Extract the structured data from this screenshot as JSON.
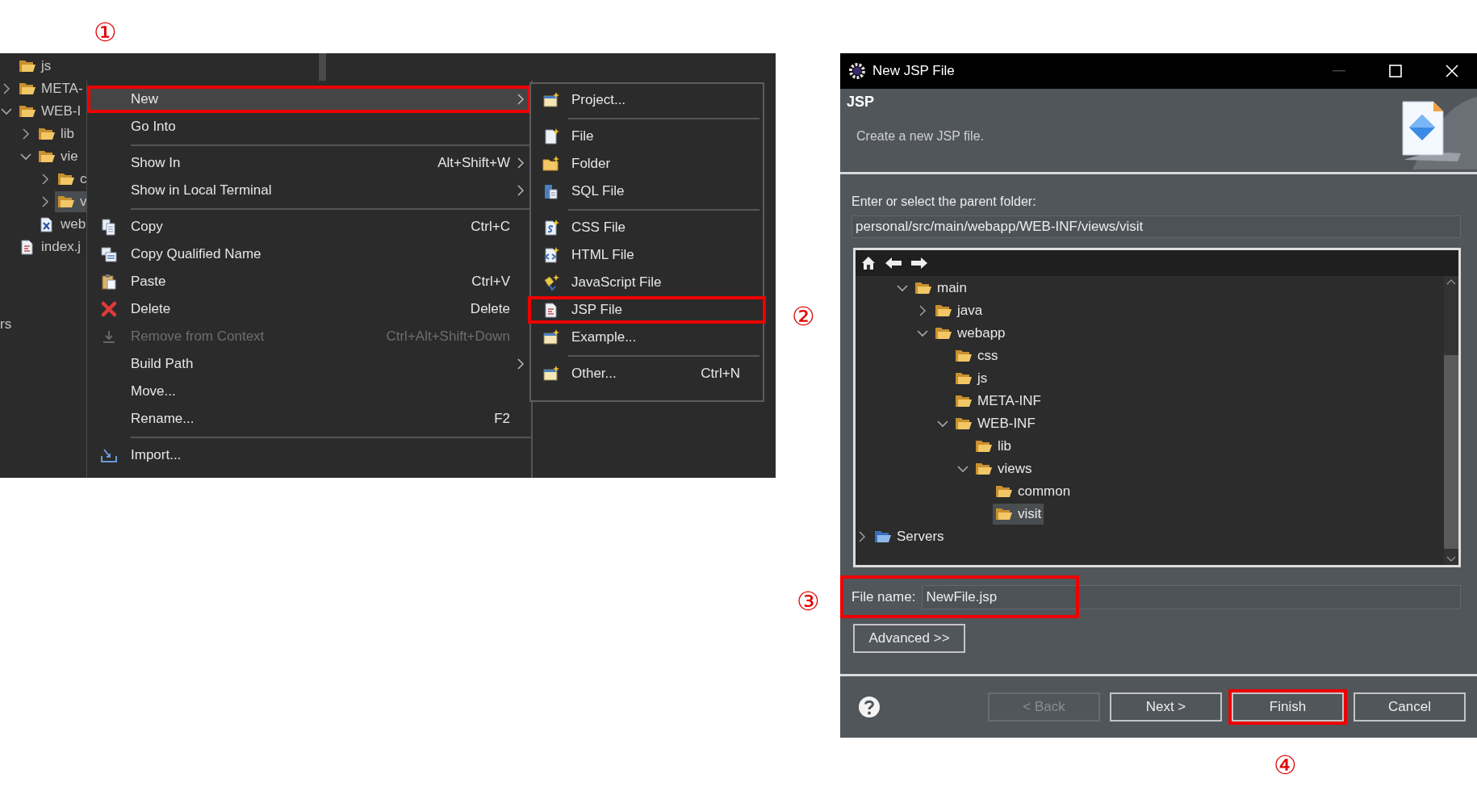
{
  "markers": [
    {
      "label": "①"
    },
    {
      "label": "②"
    },
    {
      "label": "③"
    },
    {
      "label": "④"
    }
  ],
  "explorer": {
    "items": [
      {
        "label": "js",
        "kind": "folder",
        "selected": false
      },
      {
        "label": "META-",
        "kind": "folder",
        "expanded": false,
        "selected": false
      },
      {
        "label": "WEB-I",
        "kind": "folder",
        "expanded": true,
        "selected": false,
        "children": [
          {
            "label": "lib",
            "kind": "folder",
            "expanded": false,
            "selected": false
          },
          {
            "label": "vie",
            "kind": "folder",
            "expanded": true,
            "selected": false,
            "children": [
              {
                "label": "c",
                "kind": "folder",
                "expanded": false,
                "selected": false
              },
              {
                "label": "v",
                "kind": "folder",
                "expanded": false,
                "selected": true
              }
            ]
          },
          {
            "label": "web",
            "kind": "xml-file",
            "selected": false
          }
        ]
      },
      {
        "label": "index.j",
        "kind": "jsp-file",
        "selected": false
      }
    ],
    "edge_label": "rs"
  },
  "context_menu": {
    "items": [
      {
        "kind": "plain",
        "label": "New",
        "submenu": true,
        "selected": true,
        "highlighted": true,
        "disabled": false
      },
      {
        "kind": "plain",
        "label": "Go Into",
        "submenu": false,
        "selected": false,
        "highlighted": false,
        "disabled": false
      },
      {
        "kind": "separator"
      },
      {
        "kind": "plain",
        "label": "Show In",
        "shortcut": "Alt+Shift+W",
        "submenu": true,
        "selected": false,
        "highlighted": false,
        "disabled": false
      },
      {
        "kind": "plain",
        "label": "Show in Local Terminal",
        "submenu": true,
        "selected": false,
        "highlighted": false,
        "disabled": false
      },
      {
        "kind": "separator"
      },
      {
        "kind": "copy",
        "label": "Copy",
        "shortcut": "Ctrl+C",
        "submenu": false,
        "selected": false,
        "highlighted": false,
        "disabled": false
      },
      {
        "kind": "copy-qualified",
        "label": "Copy Qualified Name",
        "submenu": false,
        "selected": false,
        "highlighted": false,
        "disabled": false
      },
      {
        "kind": "paste",
        "label": "Paste",
        "shortcut": "Ctrl+V",
        "submenu": false,
        "selected": false,
        "highlighted": false,
        "disabled": false
      },
      {
        "kind": "delete",
        "label": "Delete",
        "shortcut": "Delete",
        "submenu": false,
        "selected": false,
        "highlighted": false,
        "disabled": false
      },
      {
        "kind": "remove",
        "label": "Remove from Context",
        "shortcut": "Ctrl+Alt+Shift+Down",
        "submenu": false,
        "selected": false,
        "highlighted": false,
        "disabled": true
      },
      {
        "kind": "plain",
        "label": "Build Path",
        "submenu": true,
        "selected": false,
        "highlighted": false,
        "disabled": false
      },
      {
        "kind": "plain",
        "label": "Move...",
        "submenu": false,
        "selected": false,
        "highlighted": false,
        "disabled": false
      },
      {
        "kind": "plain",
        "label": "Rename...",
        "shortcut": "F2",
        "submenu": false,
        "selected": false,
        "highlighted": false,
        "disabled": false
      },
      {
        "kind": "separator"
      },
      {
        "kind": "import",
        "label": "Import...",
        "submenu": false,
        "selected": false,
        "highlighted": false,
        "disabled": false
      }
    ]
  },
  "new_submenu": {
    "items": [
      {
        "kind": "new-project",
        "label": "Project...",
        "highlighted": false
      },
      {
        "kind": "separator"
      },
      {
        "kind": "new-file",
        "label": "File",
        "highlighted": false
      },
      {
        "kind": "new-folder",
        "label": "Folder",
        "highlighted": false
      },
      {
        "kind": "sql-file",
        "label": "SQL File",
        "highlighted": false
      },
      {
        "kind": "separator"
      },
      {
        "kind": "css-file",
        "label": "CSS File",
        "highlighted": false
      },
      {
        "kind": "html-file",
        "label": "HTML File",
        "highlighted": false
      },
      {
        "kind": "js-file",
        "label": "JavaScript File",
        "highlighted": false
      },
      {
        "kind": "jsp-file",
        "label": "JSP File",
        "highlighted": true
      },
      {
        "kind": "new-project",
        "label": "Example...",
        "highlighted": false
      },
      {
        "kind": "separator"
      },
      {
        "kind": "new-project",
        "label": "Other...",
        "shortcut": "Ctrl+N",
        "highlighted": false
      }
    ]
  },
  "dialog": {
    "title": "New JSP File",
    "header": {
      "title": "JSP",
      "description": "Create a new JSP file."
    },
    "folder_label": "Enter or select the parent folder:",
    "folder_path": "personal/src/main/webapp/WEB-INF/views/visit",
    "tree": {
      "items": [
        {
          "label": "main",
          "kind": "folder",
          "expanded": true,
          "selected": false,
          "children": [
            {
              "label": "java",
              "kind": "folder",
              "expanded": false,
              "selected": false
            },
            {
              "label": "webapp",
              "kind": "folder",
              "expanded": true,
              "selected": false,
              "children": [
                {
                  "label": "css",
                  "kind": "folder",
                  "selected": false
                },
                {
                  "label": "js",
                  "kind": "folder",
                  "selected": false
                },
                {
                  "label": "META-INF",
                  "kind": "folder",
                  "selected": false
                },
                {
                  "label": "WEB-INF",
                  "kind": "folder",
                  "expanded": true,
                  "selected": false,
                  "children": [
                    {
                      "label": "lib",
                      "kind": "folder",
                      "selected": false
                    },
                    {
                      "label": "views",
                      "kind": "folder",
                      "expanded": true,
                      "selected": false,
                      "children": [
                        {
                          "label": "common",
                          "kind": "folder",
                          "selected": false
                        },
                        {
                          "label": "visit",
                          "kind": "folder",
                          "selected": true
                        }
                      ]
                    }
                  ]
                }
              ]
            }
          ]
        },
        {
          "label": "Servers",
          "kind": "project",
          "expanded": false,
          "selected": false
        }
      ]
    },
    "file_name": {
      "label": "File name:",
      "value": "NewFile.jsp",
      "highlighted": true
    },
    "advanced_button": "Advanced >>",
    "buttons": [
      {
        "label": "< Back",
        "disabled": true,
        "highlighted": false
      },
      {
        "label": "Next >",
        "disabled": false,
        "highlighted": false
      },
      {
        "label": "Finish",
        "disabled": false,
        "highlighted": true
      },
      {
        "label": "Cancel",
        "disabled": false,
        "highlighted": false
      }
    ]
  }
}
